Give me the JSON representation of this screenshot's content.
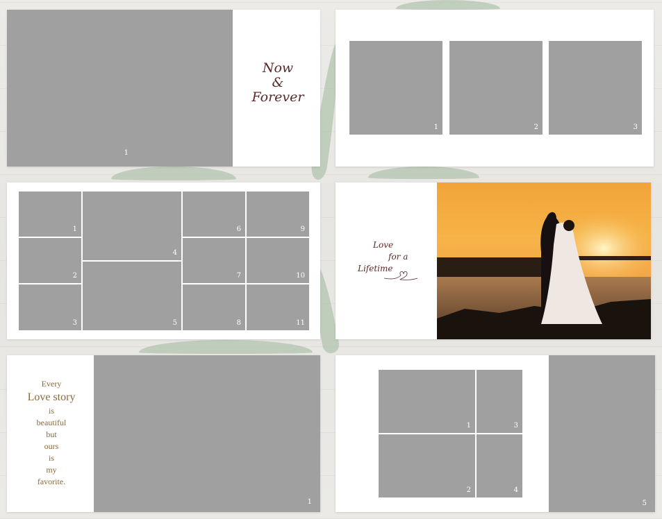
{
  "spread1": {
    "photo_number": "1",
    "text_line1": "Now",
    "text_line2": "&",
    "text_line3": "Forever"
  },
  "spread2": {
    "photo_numbers": [
      "1",
      "2",
      "3"
    ]
  },
  "spread3": {
    "photo_numbers": [
      "1",
      "2",
      "3",
      "4",
      "5",
      "6",
      "7",
      "8",
      "9",
      "10",
      "11"
    ]
  },
  "spread4": {
    "text_line1": "Love",
    "text_line2": "for a",
    "text_line3": "Lifetime",
    "photo_subject": "couple-silhouette-sunset"
  },
  "spread5": {
    "lines": [
      "Every",
      "Love story",
      "is",
      "beautiful",
      "but",
      "ours",
      "is",
      "my",
      "favorite."
    ],
    "photo_number": "1"
  },
  "spread6": {
    "photo_numbers": [
      "1",
      "2",
      "3",
      "4",
      "5"
    ]
  },
  "colors": {
    "placeholder": "#a0a0a0",
    "script_text": "#5a2a2a",
    "gold_text": "#8a6a3a"
  }
}
